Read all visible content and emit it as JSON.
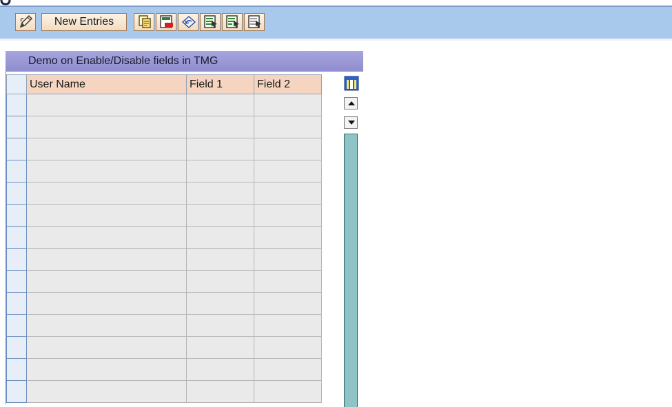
{
  "toolbar": {
    "buttons": [
      {
        "id": "change",
        "icon": "pencil-icon"
      },
      {
        "id": "new_entries",
        "label": "New Entries"
      },
      {
        "id": "copy",
        "icon": "copy-icon"
      },
      {
        "id": "delete",
        "icon": "delete-icon"
      },
      {
        "id": "undo",
        "icon": "undo-icon"
      },
      {
        "id": "select_all",
        "icon": "select-all-icon"
      },
      {
        "id": "select_block",
        "icon": "select-block-icon"
      },
      {
        "id": "deselect_all",
        "icon": "deselect-all-icon"
      }
    ],
    "new_entries_label": "New Entries"
  },
  "table": {
    "title": "Demo on Enable/Disable fields in TMG",
    "columns": [
      "User Name",
      "Field 1",
      "Field 2"
    ],
    "rows": [
      [
        "",
        "",
        ""
      ],
      [
        "",
        "",
        ""
      ],
      [
        "",
        "",
        ""
      ],
      [
        "",
        "",
        ""
      ],
      [
        "",
        "",
        ""
      ],
      [
        "",
        "",
        ""
      ],
      [
        "",
        "",
        ""
      ],
      [
        "",
        "",
        ""
      ],
      [
        "",
        "",
        ""
      ],
      [
        "",
        "",
        ""
      ],
      [
        "",
        "",
        ""
      ],
      [
        "",
        "",
        ""
      ],
      [
        "",
        "",
        ""
      ],
      [
        "",
        "",
        ""
      ]
    ]
  },
  "icons": {
    "column_config": "column-config-icon",
    "scroll_up": "arrow-up-icon",
    "scroll_down": "arrow-down-icon"
  },
  "colors": {
    "toolbar_bg": "#a8c8ec",
    "title_bar": "#8f8ccf",
    "header_bg": "#f5d5c0",
    "cell_bg": "#eaeaea",
    "scroll_track": "#8ec4c6"
  }
}
